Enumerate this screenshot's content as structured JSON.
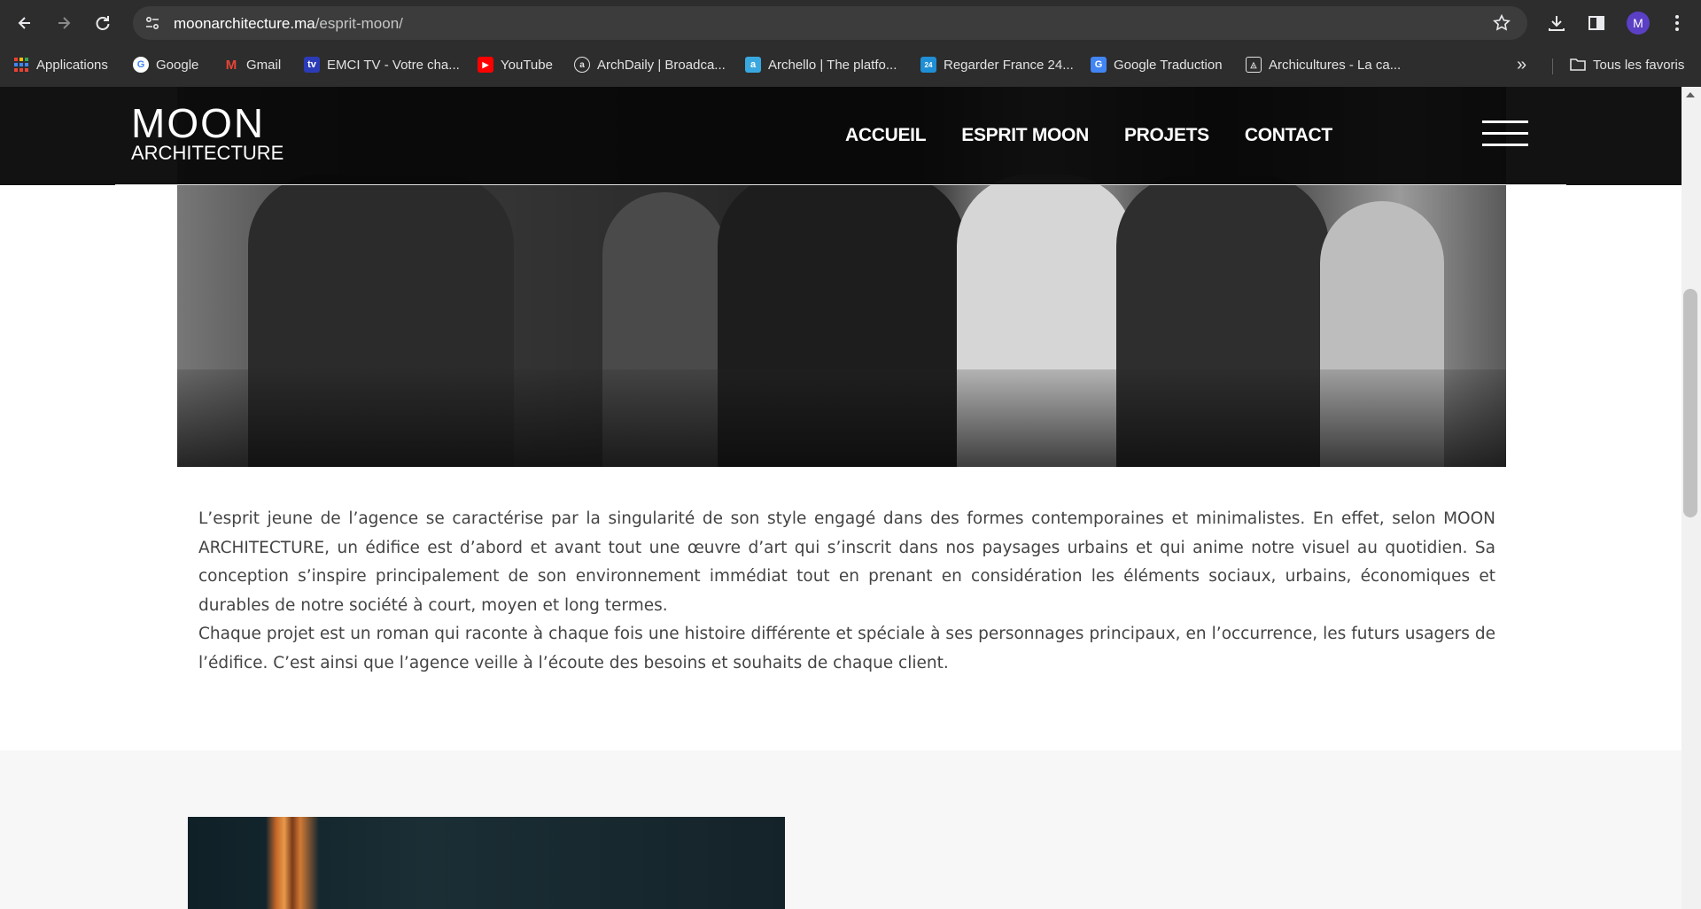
{
  "browser": {
    "url_host": "moonarchitecture.ma",
    "url_path": "/esprit-moon/",
    "profile_initial": "M",
    "bookmarks": [
      {
        "label": "Applications",
        "icon": "apps-grid-icon"
      },
      {
        "label": "Google",
        "icon": "google-icon"
      },
      {
        "label": "Gmail",
        "icon": "gmail-icon"
      },
      {
        "label": "EMCI TV - Votre cha...",
        "icon": "emci-tv-icon"
      },
      {
        "label": "YouTube",
        "icon": "youtube-icon"
      },
      {
        "label": "ArchDaily | Broadca...",
        "icon": "archdaily-icon"
      },
      {
        "label": "Archello | The platfo...",
        "icon": "archello-icon"
      },
      {
        "label": "Regarder France 24...",
        "icon": "france24-icon"
      },
      {
        "label": "Google Traduction",
        "icon": "google-translate-icon"
      },
      {
        "label": "Archicultures - La ca...",
        "icon": "archicultures-icon"
      }
    ],
    "overflow_label": "»",
    "all_bookmarks_label": "Tous les favoris"
  },
  "site": {
    "logo_top": "MOON",
    "logo_bottom": "ARCHITECTURE",
    "nav": [
      "ACCUEIL",
      "ESPRIT MOON",
      "PROJETS",
      "CONTACT"
    ]
  },
  "content": {
    "paragraph_1": "L’esprit jeune de l’agence se caractérise par la singularité de son style engagé dans des formes contemporaines et minimalistes. En effet, selon MOON ARCHITECTURE, un édifice est d’abord et avant tout une œuvre d’art qui s’inscrit dans nos paysages urbains et qui anime notre visuel au quotidien. Sa conception s’inspire principalement de son environnement immédiat tout en prenant en considération les éléments sociaux, urbains, économiques et durables de notre société à court, moyen et long termes.",
    "paragraph_2": "Chaque projet est un roman qui raconte à chaque fois une histoire différente et spéciale à ses personnages principaux, en l’occurrence, les futurs usagers de l’édifice. C’est ainsi que l’agence veille à l’écoute des besoins et souhaits de chaque client."
  },
  "colors": {
    "chrome_bg": "#2d2d2d",
    "header_bg": "#080808",
    "body_text": "#444444",
    "section_grey": "#f7f7f7"
  }
}
